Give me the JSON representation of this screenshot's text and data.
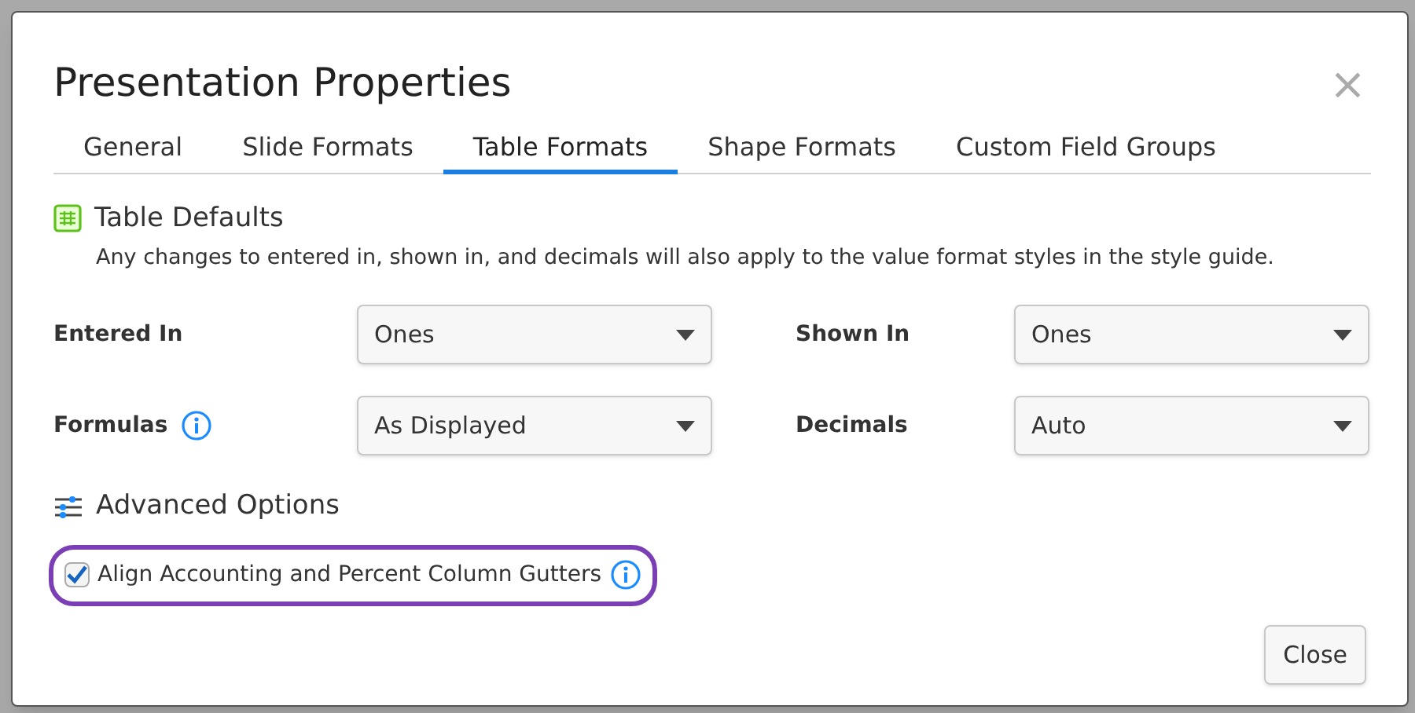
{
  "dialog": {
    "title": "Presentation Properties",
    "close_glyph": "×"
  },
  "tabs": [
    {
      "label": "General",
      "selected": false
    },
    {
      "label": "Slide Formats",
      "selected": false
    },
    {
      "label": "Table Formats",
      "selected": true
    },
    {
      "label": "Shape Formats",
      "selected": false
    },
    {
      "label": "Custom Field Groups",
      "selected": false
    }
  ],
  "table_defaults": {
    "title": "Table Defaults",
    "description": "Any changes to entered in, shown in, and decimals will also apply to the value format styles in the style guide."
  },
  "fields": [
    {
      "label": "Entered In",
      "info": false,
      "value": "Ones"
    },
    {
      "label": "Shown In",
      "info": false,
      "value": "Ones"
    },
    {
      "label": "Formulas",
      "info": true,
      "value": "As Displayed"
    },
    {
      "label": "Decimals",
      "info": false,
      "value": "Auto"
    }
  ],
  "advanced": {
    "title": "Advanced Options",
    "option": {
      "label": "Align Accounting and Percent Column Gutters",
      "checked": true,
      "highlighted": true,
      "info": true
    }
  },
  "buttons": [
    "Close"
  ]
}
